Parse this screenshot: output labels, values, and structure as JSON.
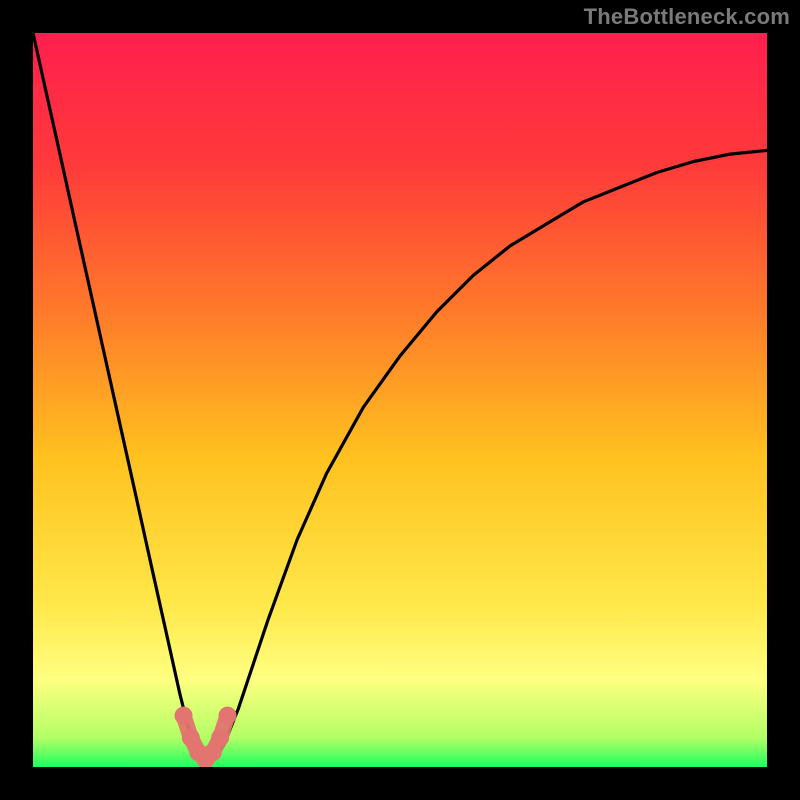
{
  "watermark": "TheBottleneck.com",
  "colors": {
    "bg": "#000000",
    "gradient_top": "#ff1f4e",
    "gradient_mid_top": "#ff6a2a",
    "gradient_mid": "#ffd21f",
    "gradient_mid_bot": "#ffff66",
    "gradient_bot": "#1fff5f",
    "curve": "#000000",
    "marker": "#e2756f"
  },
  "chart_data": {
    "type": "line",
    "title": "",
    "xlabel": "",
    "ylabel": "",
    "xlim": [
      0,
      100
    ],
    "ylim": [
      0,
      100
    ],
    "series": [
      {
        "name": "bottleneck-curve",
        "x": [
          0,
          2,
          4,
          6,
          8,
          10,
          12,
          14,
          16,
          18,
          20,
          21,
          22,
          23,
          24,
          26,
          28,
          30,
          32,
          36,
          40,
          45,
          50,
          55,
          60,
          65,
          70,
          75,
          80,
          85,
          90,
          95,
          100
        ],
        "y": [
          100,
          91,
          82,
          73,
          64,
          55,
          46,
          37,
          28,
          19,
          10,
          6,
          3,
          1,
          0.5,
          3,
          8,
          14,
          20,
          31,
          40,
          49,
          56,
          62,
          67,
          71,
          74,
          77,
          79,
          81,
          82.5,
          83.5,
          84
        ]
      }
    ],
    "markers": {
      "name": "highlight-points",
      "x": [
        20.5,
        21.5,
        22.5,
        23.5,
        24.5,
        25.5,
        26.5
      ],
      "y": [
        7,
        4,
        2,
        1,
        2,
        4,
        7
      ]
    }
  }
}
